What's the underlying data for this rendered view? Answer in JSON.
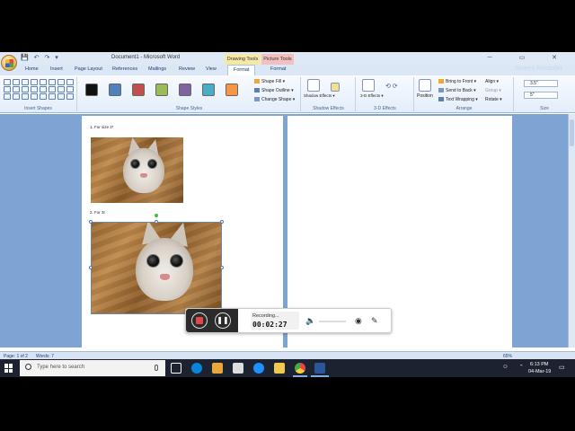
{
  "window": {
    "title": "Document1 - Microsoft Word",
    "quick_access": "💾 ↶ ↷ ▾",
    "context_tabs": {
      "drawing": "Drawing Tools",
      "picture": "Picture Tools"
    },
    "controls": "─ ▭ ✕"
  },
  "ribbon": {
    "tabs": [
      "Home",
      "Insert",
      "Page Layout",
      "References",
      "Mailings",
      "Review",
      "View",
      "Format",
      "Format"
    ],
    "active_tab": "Format",
    "watermark": "Screen Recorder",
    "groups": {
      "insert_shapes": "Insert Shapes",
      "shape_styles": "Shape Styles",
      "shadow_effects": "Shadow Effects",
      "three_d_effects": "3-D Effects",
      "arrange": "Arrange",
      "size": "Size"
    },
    "style_swatches": [
      "#111111",
      "#4f81bd",
      "#c0504d",
      "#9bbb59",
      "#8064a2",
      "#4bacc6",
      "#f79646"
    ],
    "shape_fill": "Shape Fill ▾",
    "shape_outline": "Shape Outline ▾",
    "change_shape": "Change Shape ▾",
    "shadow_effects_btn": "Shadow Effects ▾",
    "three_d_btn": "3-D Effects ▾",
    "position": "Position",
    "bring_to_front": "Bring to Front ▾",
    "send_to_back": "Send to Back ▾",
    "text_wrapping": "Text Wrapping ▾",
    "align": "Align ▾",
    "group": "Group ▾",
    "rotate": "Rotate ▾",
    "height": "3.5\"",
    "width": "5\""
  },
  "document": {
    "item1": "1.     For size 2*",
    "item2": "2.     For 3r"
  },
  "recorder": {
    "status": "Recording...",
    "time": "00:02:27"
  },
  "statusbar": {
    "page": "Page: 1 of 2",
    "words": "Words: 7",
    "zoom": "65%"
  },
  "taskbar": {
    "search_placeholder": "Type here to search",
    "time": "6:13 PM",
    "date": "04-Mar-19"
  }
}
